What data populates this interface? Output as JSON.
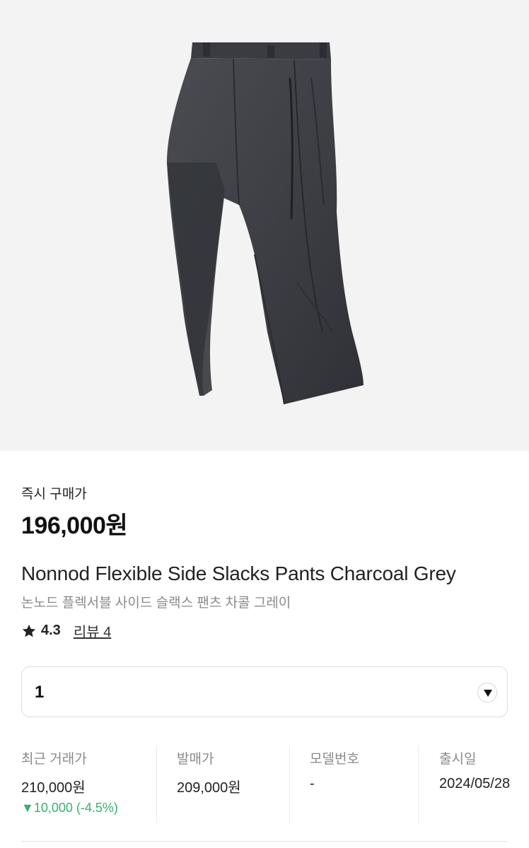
{
  "product": {
    "image_icon": "product-photo-charcoal-slacks"
  },
  "purchase": {
    "label": "즉시 구매가",
    "price": "196,000원"
  },
  "title": {
    "english": "Nonnod Flexible Side Slacks Pants Charcoal Grey",
    "korean": "논노드 플렉서블 사이드 슬랙스 팬츠 차콜 그레이"
  },
  "rating": {
    "icon": "star-icon",
    "score": "4.3",
    "review_link": "리뷰 4"
  },
  "size_select": {
    "value": "1",
    "icon": "chevron-down-icon"
  },
  "stats": [
    {
      "label": "최근 거래가",
      "value": "210,000원",
      "change": "▼10,000 (-4.5%)"
    },
    {
      "label": "발매가",
      "value": "209,000원"
    },
    {
      "label": "모델번호",
      "value": "-"
    },
    {
      "label": "출시일",
      "value": "2024/05/28"
    }
  ],
  "colors": {
    "change_down": "#31b46e",
    "hero_bg": "#f3f3f4"
  }
}
